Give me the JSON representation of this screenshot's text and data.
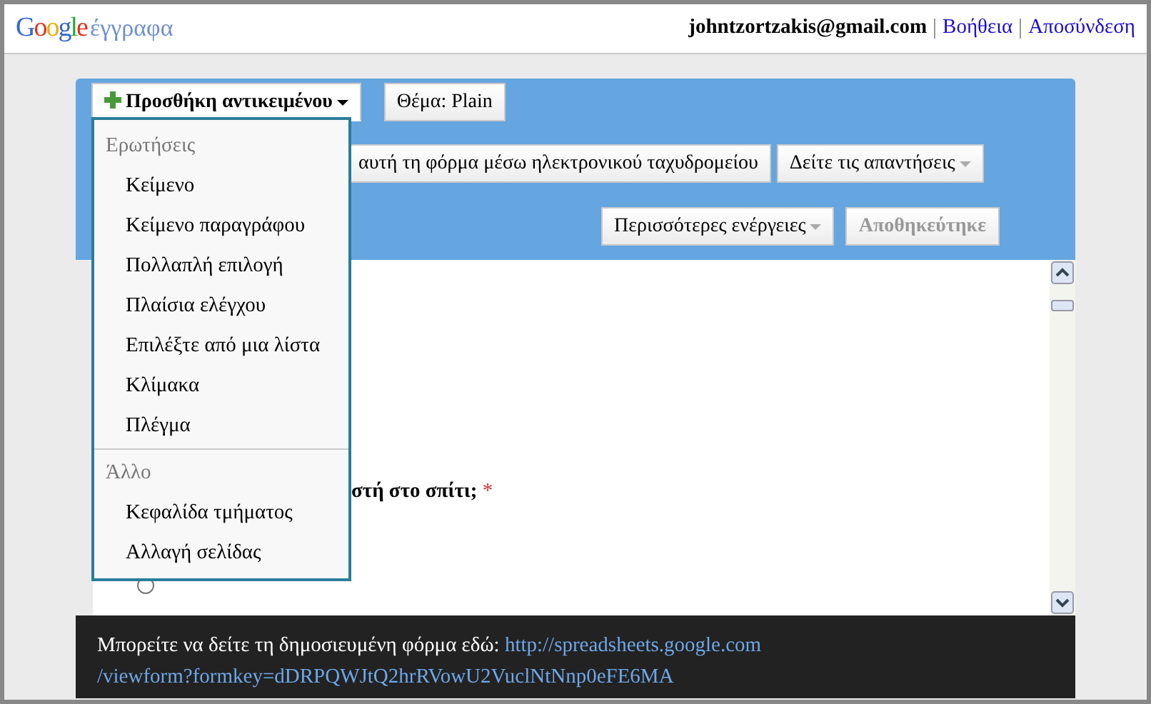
{
  "header": {
    "logo": "Google",
    "product": "έγγραφα",
    "account": "johntzortzakis@gmail.com",
    "links": [
      "Βοήθεια",
      "Αποσύνδεση"
    ]
  },
  "toolbar": {
    "add_button": {
      "label": "Προσθήκη αντικειμένου",
      "expanded": true
    },
    "theme_button": {
      "label": "Θέμα:  Plain"
    },
    "email_button": {
      "label": "αυτή τη φόρμα μέσω ηλεκτρονικού ταχυδρομείου"
    },
    "responses_button": {
      "label": "Δείτε τις απαντήσεις"
    },
    "more_button": {
      "label": "Περισσότερες ενέργειες"
    },
    "save_button": {
      "label": "Αποθηκεύτηκε",
      "disabled": true
    }
  },
  "menu": {
    "sections": [
      {
        "heading": "Ερωτήσεις",
        "items": [
          "Κείμενο",
          "Κείμενο παραγράφου",
          "Πολλαπλή επιλογή",
          "Πλαίσια ελέγχου",
          "Επιλέξτε από μια λίστα",
          "Κλίμακα",
          "Πλέγμα"
        ]
      },
      {
        "heading": "Άλλο",
        "items": [
          "Κεφαλίδα τμήματος",
          "Αλλαγή σελίδας"
        ]
      }
    ]
  },
  "form": {
    "question": "στή στο σπίτι;",
    "required": true,
    "required_mark": "*",
    "option": {
      "selected": false
    }
  },
  "footer": {
    "text": "Μπορείτε να δείτε τη δημοσιευμένη φόρμα εδώ:",
    "link_line1": "http://spreadsheets.google.com",
    "link_line2": "/viewform?formkey=dDRPQWJtQ2hrRVowU2VuclNtNnp0eFE6MA"
  }
}
